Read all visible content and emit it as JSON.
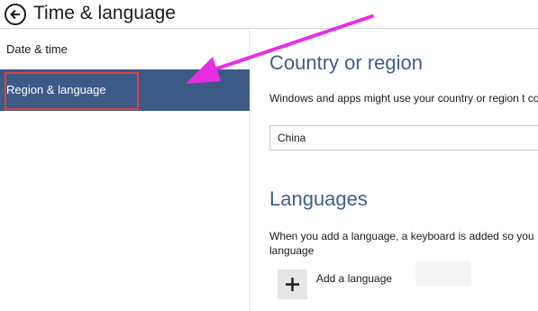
{
  "window": {
    "title": "Time & language"
  },
  "sidebar": {
    "items": [
      {
        "label": "Date & time"
      },
      {
        "label": "Region & language"
      }
    ]
  },
  "main": {
    "country": {
      "heading": "Country or region",
      "description": "Windows and apps might use your country or region t content",
      "selected_value": "China"
    },
    "languages": {
      "heading": "Languages",
      "description": "When you add a language, a keyboard is added so you language",
      "add_label": "Add a language"
    }
  },
  "colors": {
    "accent": "#3c5a86",
    "heading": "#3f5e8c",
    "annotation_box": "#e0413a",
    "annotation_arrow": "#e82ee3"
  },
  "icons": {
    "back": "back-arrow-circle-icon",
    "add": "plus-icon"
  }
}
